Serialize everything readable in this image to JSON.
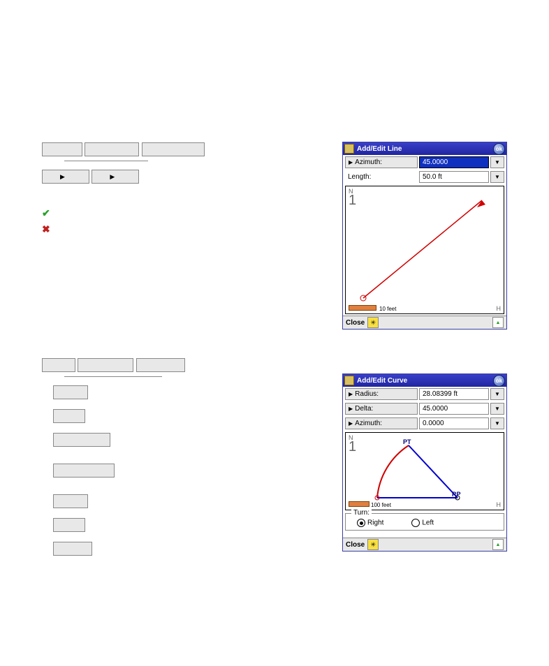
{
  "left_section_line": {
    "top_buttons": [
      "",
      "",
      ""
    ],
    "mid_buttons": [
      "",
      ""
    ]
  },
  "win_line": {
    "title": "Add/Edit Line",
    "ok": "ok",
    "row1": {
      "label": "Azimuth:",
      "value": "45.0000"
    },
    "row2": {
      "label": "Length:",
      "value": "50.0 ft"
    },
    "north": "N",
    "north_digit": "1",
    "scale_text": "10 feet",
    "corner": "H",
    "close": "Close"
  },
  "win_curve": {
    "title": "Add/Edit Curve",
    "ok": "ok",
    "row1": {
      "label": "Radius:",
      "value": "28.08399 ft"
    },
    "row2": {
      "label": "Delta:",
      "value": "45.0000"
    },
    "row3": {
      "label": "Azimuth:",
      "value": "0.0000"
    },
    "north": "N",
    "north_digit": "1",
    "label_pt": "PT",
    "label_rp": "RP",
    "scale_text": "100 feet",
    "corner": "H",
    "turn": {
      "label": "Turn:",
      "right": "Right",
      "left": "Left"
    },
    "close": "Close"
  }
}
